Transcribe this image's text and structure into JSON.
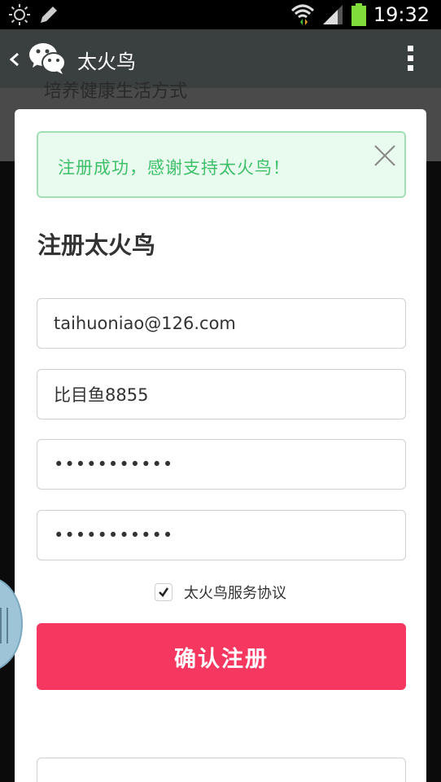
{
  "statusbar": {
    "time": "19:32",
    "icons": [
      "brightness-icon",
      "edit-icon",
      "wifi-icon",
      "signal-icon",
      "battery-icon"
    ]
  },
  "appbar": {
    "title": "太火鸟",
    "icons": [
      "back-icon",
      "wechat-icon",
      "more-icon"
    ]
  },
  "background_page": {
    "partial_text": "培养健康生活方式"
  },
  "alert": {
    "message": "注册成功，感谢支持太火鸟！",
    "close_icon": "close-icon"
  },
  "form": {
    "title": "注册太火鸟",
    "email_value": "taihuoniao@126.com",
    "nickname_value": "比目鱼8855",
    "password_value": "•••••••••••",
    "confirm_password_value": "•••••••••••",
    "agreement_label": "太火鸟服务协议",
    "agreement_checked": true,
    "submit_label": "确认注册"
  },
  "colors": {
    "accent": "#f6375f",
    "success_text": "#3ec06a",
    "success_bg": "#e9fbee",
    "appbar_bg": "#3a3f40"
  }
}
